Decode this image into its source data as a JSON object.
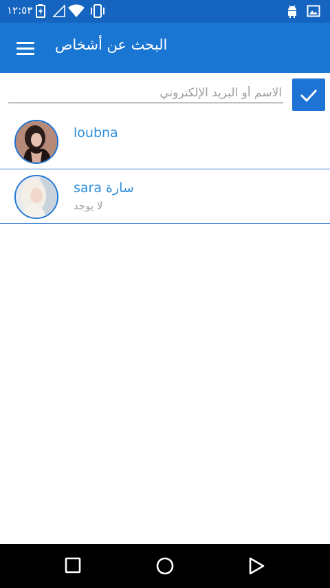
{
  "status_bar": {
    "time": "١٢:٥٣",
    "icons": [
      "battery-charging-icon",
      "signal-icon",
      "wifi-icon",
      "vibrate-icon",
      "android-icon",
      "image-icon"
    ]
  },
  "app_bar": {
    "title": "البحث عن أشخاص",
    "menu_icon": "hamburger-menu-icon"
  },
  "search": {
    "placeholder": "الاسم أو البريد الإلكتروني",
    "value": "",
    "confirm_icon": "check-icon"
  },
  "contacts": [
    {
      "name": "loubna",
      "subtitle": "",
      "avatar": "avatar-photo"
    },
    {
      "name": "sara سارة",
      "subtitle": "لا يوجد",
      "avatar": "avatar-photo"
    }
  ],
  "nav_bar": {
    "buttons": [
      "recents-square-icon",
      "home-circle-icon",
      "back-triangle-icon"
    ]
  },
  "colors": {
    "status_bar": "#1565c0",
    "app_bar": "#1976d2",
    "accent": "#1e74d4",
    "contact_name": "#2f8fdc",
    "divider": "#3e82cc"
  }
}
